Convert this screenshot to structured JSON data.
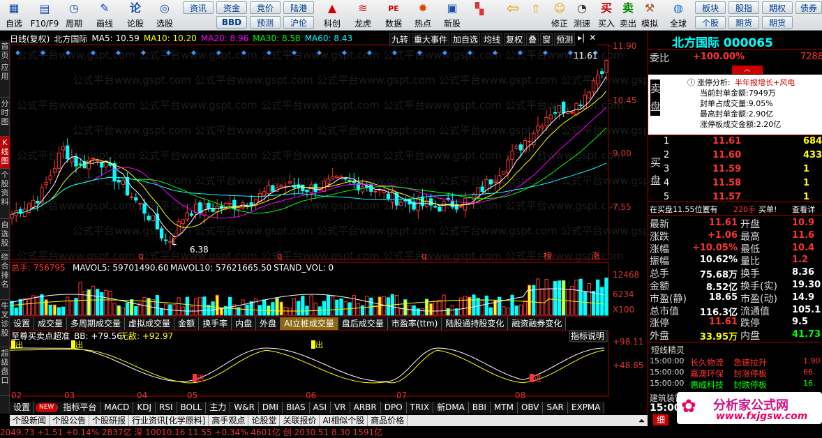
{
  "toolbar": {
    "items": [
      {
        "label": "自选",
        "icon": "star-icon"
      },
      {
        "label": "F10/F9",
        "icon": "document-icon"
      },
      {
        "label": "周期",
        "icon": "clock-icon"
      },
      {
        "label": "画线",
        "icon": "pencil-icon"
      },
      {
        "label": "论股",
        "icon": "chat-icon"
      },
      {
        "label": "选股",
        "icon": "target-icon"
      }
    ],
    "grid1": [
      "资讯",
      "资金",
      "竞价",
      "陆港"
    ],
    "grid2": [
      "BBD",
      "预测",
      "沪伦"
    ],
    "mid": [
      {
        "label": "科创",
        "icon": "chart-icon"
      },
      {
        "label": "龙虎",
        "icon": "dragon-icon"
      },
      {
        "label": "数据",
        "icon": "pe-icon"
      },
      {
        "label": "热点",
        "icon": "hot-icon"
      },
      {
        "label": "新股",
        "icon": "new-stock-icon"
      }
    ],
    "right": [
      {
        "label": "修正",
        "icon": "face-icon"
      },
      {
        "label": "测速",
        "icon": "speed-icon"
      },
      {
        "label": "买入",
        "icon": "buy-icon"
      },
      {
        "label": "卖出",
        "icon": "sell-icon"
      },
      {
        "label": "模拟",
        "icon": "hammer-icon"
      },
      {
        "label": "全球",
        "icon": "globe-icon"
      }
    ],
    "grid3": [
      "板块",
      "股指",
      "期权",
      "债券",
      "个股",
      "期货",
      "期货"
    ],
    "buy_char": "买",
    "sell_char": "卖",
    "pe_char": "PE"
  },
  "sidebar": [
    "首页",
    "应用",
    "分时图",
    "K线图",
    "个股资料",
    "自选股",
    "综合排名",
    "牛叉诊股",
    "超级盘口"
  ],
  "chart": {
    "header_label": "日线(复权)",
    "stock_name": "北方国际",
    "ma5": "MA5: 10.59",
    "ma10": "MA10: 10.20",
    "ma20": "MA20: 8.96",
    "ma30": "MA30: 8.58",
    "ma60": "MA60: 8.43",
    "buttons": [
      "九转",
      "重大事件",
      "加自选",
      "均线",
      "复权",
      "叠",
      "窗",
      "预测"
    ],
    "price_ticks": [
      "11.90",
      "10.45",
      "9.00",
      "7.55"
    ],
    "high_label": "11.61",
    "low_label": "6.38",
    "markers": [
      "q",
      "L",
      "q",
      "q",
      "榜",
      "涨"
    ],
    "vol_line": {
      "label": "总手: 756795",
      "mavol5": "MAVOL5: 59701490.60",
      "mavol10": "MAVOL10: 57621665.50",
      "stand": "STAND_VOL: 0"
    },
    "vol_ticks": [
      "12468",
      "6234",
      "X100"
    ],
    "tabs": [
      "设置",
      "成交量",
      "多周期成交量",
      "虚拟成交量",
      "金额",
      "换手率",
      "内盘",
      "外盘",
      "AI立桩成交量",
      "盘后成交量",
      "市盈率(ttm)",
      "陆股通持股变化",
      "融资融券变化"
    ],
    "ind_label": "至尊买卖点超准",
    "ind_bb": "BB: +79.56",
    "ind_wd": "无敌: +92.97",
    "ind_button": "指标说明",
    "ind_ticks": [
      "+98.11",
      "+48.85"
    ],
    "months": [
      "02",
      "03",
      "04",
      "05",
      "06",
      "07",
      "08"
    ],
    "indicator_tabs": [
      "设置",
      "NEW",
      "指标平台",
      "MACD",
      "KDJ",
      "RSI",
      "BOLL",
      "主力",
      "W&R",
      "DMI",
      "BIAS",
      "ASI",
      "VR",
      "ARBR",
      "DPO",
      "TRIX",
      "新DMA",
      "BBI",
      "MTM",
      "OBV",
      "SAR",
      "EXPMA"
    ],
    "bottom_tabs": [
      "个股新闻",
      "个股公告",
      "个股研报",
      "行业资讯[化学原料]",
      "高手观点",
      "论股堂",
      "关联报价",
      "AI相似个股",
      "商品价格"
    ],
    "watermark": "公式平台www.gspt.com",
    "chu": "出",
    "jin": "进"
  },
  "right": {
    "title": "北方国际 000065",
    "weibi_label": "委比",
    "weibi_val": "+100.00%",
    "weibi_side": "7288",
    "zt_label": "涨停分析:",
    "zt_reason": "半年报增长+风电",
    "seal_lines": [
      "当前封单金额:7949万",
      "封单占成交量:9.05%",
      "最高封单金额:2.90亿",
      "涨停板成交金额:2.20亿"
    ],
    "sell_label": "卖盘",
    "buy_label": "买盘",
    "bids": [
      {
        "n": "1",
        "p": "11.61",
        "v": "6840"
      },
      {
        "n": "2",
        "p": "11.60",
        "v": "433"
      },
      {
        "n": "3",
        "p": "11.59",
        "v": "1"
      },
      {
        "n": "4",
        "p": "11.58",
        "v": "1"
      },
      {
        "n": "5",
        "p": "11.57",
        "v": "1"
      }
    ],
    "zaimai": "在买盘11.55位置有",
    "zaimai_v": "220手",
    "zaimai_tail": "买单!",
    "view_detail": "查看详",
    "quotes": [
      {
        "l": "最新",
        "v": "11.61",
        "l2": "开盘",
        "v2": "10.9"
      },
      {
        "l": "涨跌",
        "v": "+1.06",
        "l2": "最高",
        "v2": "11.6"
      },
      {
        "l": "涨幅",
        "v": "+10.05%",
        "l2": "最低",
        "v2": "10.4"
      },
      {
        "l": "振幅",
        "v": "10.62%",
        "l2": "量比",
        "v2": "1.2"
      },
      {
        "l": "总手",
        "v": "75.68万",
        "l2": "换手",
        "v2": "8.36"
      },
      {
        "l": "金额",
        "v": "8.52亿",
        "l2": "换手(实)",
        "v2": "19.30"
      },
      {
        "l": "市盈(静)",
        "v": "18.65",
        "l2": "市盈(动)",
        "v2": "14.9"
      },
      {
        "l": "总市值",
        "v": "116.3亿",
        "l2": "流通值",
        "v2": "105.1"
      },
      {
        "l": "涨停",
        "v": "11.61",
        "l2": "跌停",
        "v2": "9.5"
      },
      {
        "l": "外盘",
        "v": "33.95万",
        "l2": "内盘",
        "v2": "41.73"
      }
    ],
    "spirit_title": "短线精灵",
    "spirit": [
      {
        "t": "15:00:00",
        "n": "长久物流",
        "e": "急速拉升",
        "v": "1.90"
      },
      {
        "t": "15:00:00",
        "n": "嘉澳环保",
        "e": "封涨停板",
        "v": "66."
      },
      {
        "t": "15:00:00",
        "n": "惠威科技",
        "e": "封跌停板",
        "v": "16."
      }
    ],
    "spirit_cut": "建筑装饰",
    "spirit_time": "15:00",
    "detail_tab": "细"
  },
  "logo": {
    "cn": "分析家公式网",
    "url": "www.fxjgsw.com"
  },
  "ticker": "2049.73  +1.51  +0.14%  2837亿   深 10010.16  11.55  +0.34%  4601亿  创 2030.51  8.30  1591亿"
}
